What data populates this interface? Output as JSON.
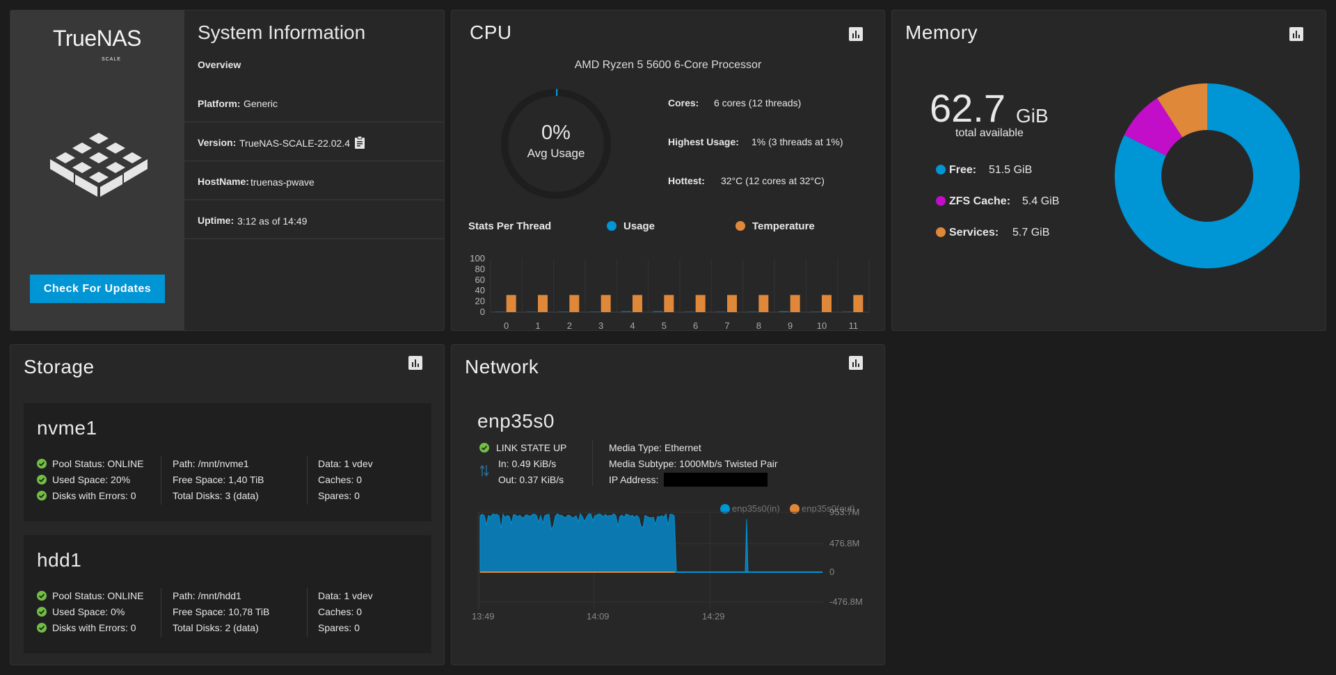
{
  "system": {
    "logo": "TrueNAS",
    "logo_sub": "SCALE",
    "title": "System Information",
    "overview": "Overview",
    "rows": [
      {
        "k": "Platform:",
        "v": "Generic"
      },
      {
        "k": "Version:",
        "v": "TrueNAS-SCALE-22.02.4"
      },
      {
        "k": "HostName:",
        "v": "truenas-pwave"
      },
      {
        "k": "Uptime:",
        "v": "3:12 as of 14:49"
      }
    ],
    "update_label": "Check For Updates"
  },
  "cpu": {
    "title": "CPU",
    "model": "AMD Ryzen 5 5600 6-Core Processor",
    "avg_value": "0%",
    "avg_label": "Avg Usage",
    "avg_fraction": 0.005,
    "stats": [
      {
        "k": "Cores:",
        "v": "6 cores  (12 threads)"
      },
      {
        "k": "Highest Usage:",
        "v": "1%  (3 threads at 1%)"
      },
      {
        "k": "Hottest:",
        "v": "32°C  (12 cores at 32°C)"
      }
    ],
    "stats_per_thread": "Stats Per Thread",
    "legend_usage": "Usage",
    "legend_temp": "Temperature",
    "colors": {
      "usage": "#0095d5",
      "temp": "#e0883a",
      "ring": "#1e1e1e"
    }
  },
  "chart_data": [
    {
      "type": "bar",
      "categories": [
        "0",
        "1",
        "2",
        "3",
        "4",
        "5",
        "6",
        "7",
        "8",
        "9",
        "10",
        "11"
      ],
      "series": [
        {
          "name": "Usage",
          "values": [
            0,
            0,
            0,
            0,
            1,
            1,
            0,
            0,
            0,
            1,
            0,
            0
          ]
        },
        {
          "name": "Temperature",
          "values": [
            32,
            32,
            32,
            32,
            32,
            32,
            32,
            32,
            32,
            32,
            32,
            32
          ]
        }
      ],
      "yticks": [
        "100",
        "80",
        "60",
        "40",
        "20",
        "0"
      ],
      "ylim": [
        0,
        100
      ]
    },
    {
      "type": "area",
      "x_ticks": [
        "13:49",
        "14:09",
        "14:29"
      ],
      "y_ticks": [
        "953.7M",
        "476.8M",
        "0",
        "-476.8M"
      ],
      "series": [
        {
          "name": "enp35s0(in)"
        },
        {
          "name": "enp35s0(out)"
        }
      ]
    }
  ],
  "memory": {
    "title": "Memory",
    "total": "62.7",
    "unit": "GiB",
    "total_label": "total available",
    "items": [
      {
        "k": "Free:",
        "v": "51.5 GiB",
        "value": 51.5,
        "color": "#0095d5"
      },
      {
        "k": "ZFS Cache:",
        "v": "5.4 GiB",
        "value": 5.4,
        "color": "#c20ec9"
      },
      {
        "k": "Services:",
        "v": "5.7 GiB",
        "value": 5.7,
        "color": "#e0883a"
      }
    ]
  },
  "storage": {
    "title": "Storage",
    "pools": [
      {
        "name": "nvme1",
        "status": [
          "Pool Status:  ONLINE",
          "Used Space:  20%",
          "Disks with Errors:  0"
        ],
        "info": [
          "Path:  /mnt/nvme1",
          "Free Space:  1,40 TiB",
          "Total Disks:  3 (data)"
        ],
        "vdev": [
          "Data:  1 vdev",
          "Caches:  0",
          "Spares:  0"
        ]
      },
      {
        "name": "hdd1",
        "status": [
          "Pool Status:  ONLINE",
          "Used Space:  0%",
          "Disks with Errors:  0"
        ],
        "info": [
          "Path:  /mnt/hdd1",
          "Free Space:  10,78 TiB",
          "Total Disks:  2 (data)"
        ],
        "vdev": [
          "Data:  1 vdev",
          "Caches:  0",
          "Spares:  0"
        ]
      }
    ]
  },
  "network": {
    "title": "Network",
    "iface": "enp35s0",
    "link": "LINK STATE UP",
    "in": "In:  0.49 KiB/s",
    "out": "Out:  0.37 KiB/s",
    "media_type": "Media Type:  Ethernet",
    "media_subtype": "Media Subtype:  1000Mb/s Twisted Pair",
    "ip_label": "IP Address:"
  }
}
